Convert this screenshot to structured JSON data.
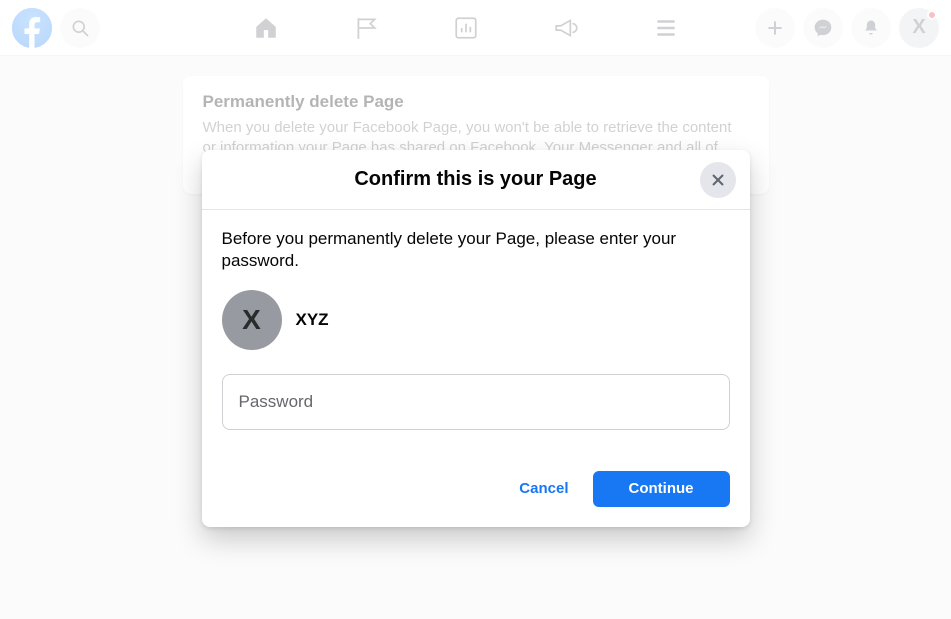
{
  "topbar": {
    "avatar_initial": "X"
  },
  "background_card": {
    "title": "Permanently delete Page",
    "desc": "When you delete your Facebook Page, you won't be able to retrieve the content or information your Page has shared on Facebook. Your Messenger and all of your"
  },
  "modal": {
    "title": "Confirm this is your Page",
    "description": "Before you permanently delete your Page, please enter your password.",
    "page_avatar_initial": "X",
    "page_name": "XYZ",
    "password_placeholder": "Password",
    "cancel_label": "Cancel",
    "continue_label": "Continue"
  }
}
